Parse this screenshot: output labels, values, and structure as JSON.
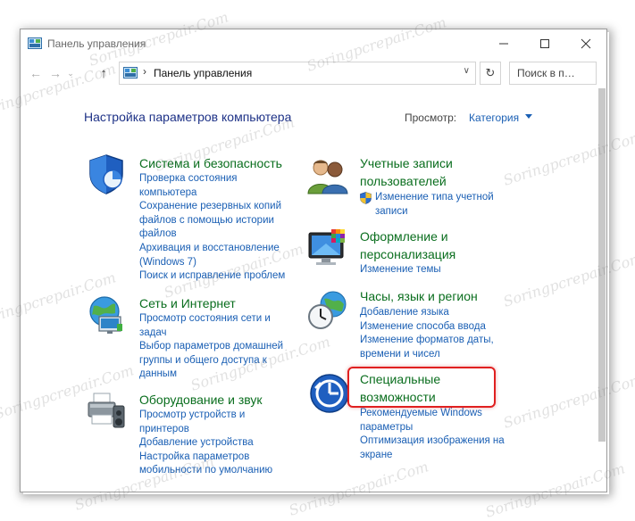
{
  "window": {
    "title": "Панель управления"
  },
  "address": {
    "path": "Панель управления",
    "separator": "›",
    "search_placeholder": "Поиск в п…"
  },
  "header": {
    "title": "Настройка параметров компьютера",
    "view_label": "Просмотр:",
    "view_value": "Категория"
  },
  "categories": {
    "security": {
      "title": "Система и безопасность",
      "links": [
        "Проверка состояния",
        "компьютера",
        "Сохранение резервных копий",
        "файлов с помощью истории",
        "файлов",
        "Архивация и восстановление",
        "(Windows 7)",
        "Поиск и исправление проблем"
      ]
    },
    "network": {
      "title": "Сеть и Интернет",
      "links": [
        "Просмотр состояния сети и",
        "задач",
        "Выбор параметров домашней",
        "группы и общего доступа к",
        "данным"
      ]
    },
    "hardware": {
      "title": "Оборудование и звук",
      "links": [
        "Просмотр устройств и",
        "принтеров",
        "Добавление устройства",
        "Настройка параметров",
        "мобильности по умолчанию"
      ]
    },
    "accounts": {
      "title": [
        "Учетные записи",
        "пользователей"
      ],
      "links": [
        "Изменение типа учетной",
        "записи"
      ]
    },
    "appearance": {
      "title": [
        "Оформление и",
        "персонализация"
      ],
      "links": [
        "Изменение темы"
      ]
    },
    "clock": {
      "title": "Часы, язык и регион",
      "links": [
        "Добавление языка",
        "Изменение способа ввода",
        "Изменение форматов даты,",
        "времени и чисел"
      ]
    },
    "ease": {
      "title": [
        "Специальные",
        "возможности"
      ],
      "links": [
        "Рекомендуемые Windows",
        "параметры",
        "Оптимизация изображения на",
        "экране"
      ]
    }
  },
  "watermark": "Soringpcrepair.Com",
  "colors": {
    "category_title": "#0a6e1e",
    "link": "#1a5fb4",
    "page_title": "#1e3287",
    "highlight": "#e02020"
  }
}
